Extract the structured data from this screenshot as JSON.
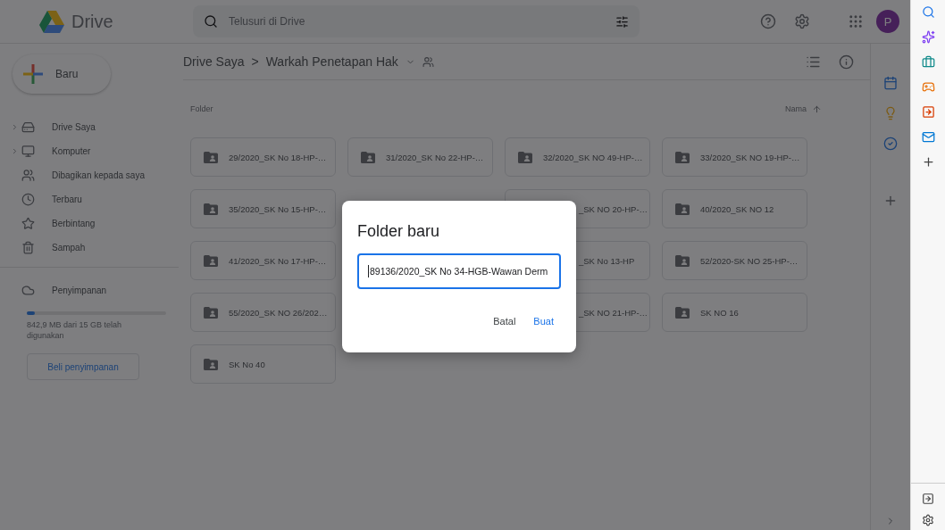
{
  "header": {
    "app_name": "Drive",
    "search": {
      "placeholder": "Telusuri di Drive"
    },
    "avatar": "P"
  },
  "sidebar": {
    "new_button": "Baru",
    "items": [
      {
        "label": "Drive Saya",
        "selected": false,
        "expanded": false
      },
      {
        "label": "Komputer",
        "selected": false,
        "expanded": false
      },
      {
        "label": "Dibagikan kepada saya",
        "selected": false
      },
      {
        "label": "Terbaru",
        "selected": false
      },
      {
        "label": "Berbintang",
        "selected": false
      },
      {
        "label": "Sampah",
        "selected": false
      }
    ],
    "storage": {
      "label": "Penyimpanan",
      "level": 0.06,
      "usage": "842,9 MB dari 15 GB telah digunakan",
      "buy_button": "Beli penyimpanan"
    }
  },
  "breadcrumb": {
    "root": "Drive Saya",
    "separator": ">",
    "current": "Warkah Penetapan Hak"
  },
  "section_title": "Folder",
  "sort": {
    "label": "Nama"
  },
  "folders": [
    {
      "name": "29/2020_SK No 18-HP-…",
      "covered": false
    },
    {
      "name": "31/2020_SK No 22-HP-…",
      "covered": false
    },
    {
      "name": "32/2020_SK NO 49-HP-…",
      "covered": false
    },
    {
      "name": "33/2020_SK NO 19-HP-…",
      "covered": false
    },
    {
      "name": "35/2020_SK No 15-HP-…",
      "covered": false
    },
    {
      "name": "_SK NO 20-HP-…",
      "covered": true
    },
    {
      "name": "40/2020_SK NO 12",
      "covered": false
    },
    {
      "name": "41/2020_SK No 17-HP-…",
      "covered": false
    },
    {
      "name": "_SK No 13-HP",
      "covered": true
    },
    {
      "name": "52/2020-SK NO 25-HP-…",
      "covered": false
    },
    {
      "name": "55/2020_SK NO 26/202…",
      "covered": false
    },
    {
      "name": "_SK NO 21-HP-…",
      "covered": true
    },
    {
      "name": "SK NO 16",
      "covered": false
    },
    {
      "name": "SK No 40",
      "covered": false
    }
  ],
  "dialog": {
    "title": "Folder baru",
    "value": "89136/2020_SK No 34-HGB-Wawan Derm",
    "buttons": [
      {
        "label": "Batal",
        "kind": "cancel"
      },
      {
        "label": "Buat",
        "kind": "confirm"
      }
    ]
  }
}
